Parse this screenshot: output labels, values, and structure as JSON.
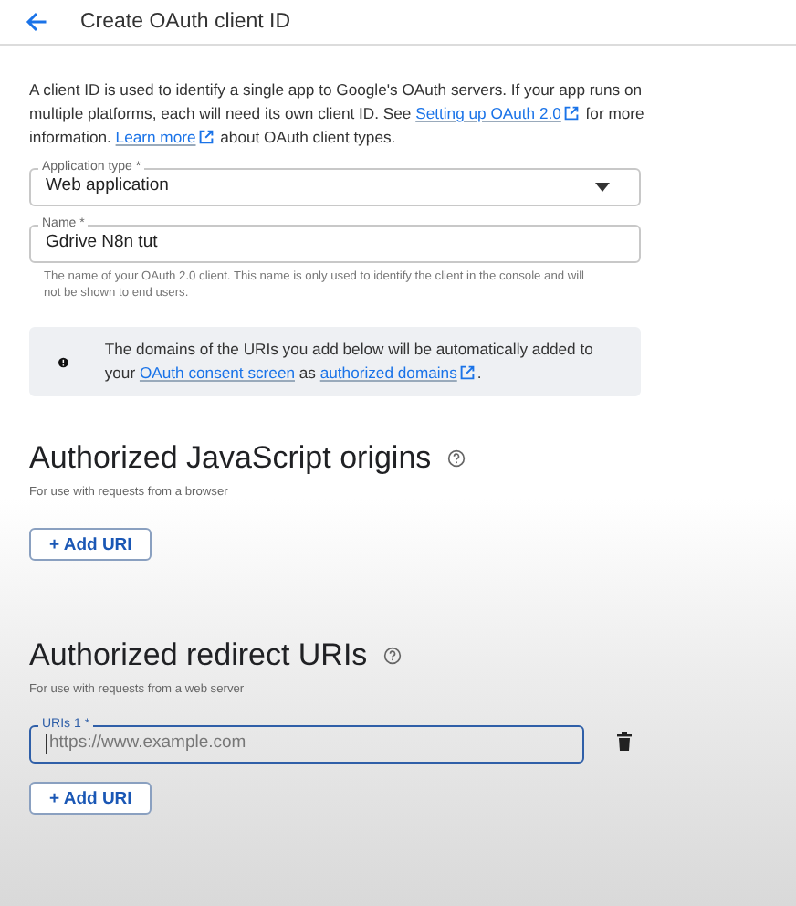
{
  "header": {
    "title": "Create OAuth client ID"
  },
  "intro": [
    {
      "kind": "text",
      "text": "A client ID is used to identify a single app to Google's OAuth servers. If your app runs on multiple platforms, each will need its own client ID. See "
    },
    {
      "kind": "link",
      "text": "Setting up OAuth 2.0",
      "external": true
    },
    {
      "kind": "text",
      "text": " for more information. "
    },
    {
      "kind": "link",
      "text": "Learn more",
      "external": true
    },
    {
      "kind": "text",
      "text": " about OAuth client types."
    }
  ],
  "application_type": {
    "label": "Application type *",
    "value": "Web application"
  },
  "name_field": {
    "label": "Name *",
    "value": "Gdrive N8n tut",
    "helper": "The name of your OAuth 2.0 client. This name is only used to identify the client in the console and will not be shown to end users."
  },
  "notice": [
    {
      "kind": "text",
      "text": "The domains of the URIs you add below will be automatically added to your "
    },
    {
      "kind": "link",
      "text": "OAuth consent screen",
      "external": false
    },
    {
      "kind": "text",
      "text": " as "
    },
    {
      "kind": "link",
      "text": "authorized domains",
      "external": true
    },
    {
      "kind": "text",
      "text": "."
    }
  ],
  "sections": [
    {
      "title": "Authorized JavaScript origins",
      "subtitle": "For use with requests from a browser",
      "add_button": "+ Add URI"
    },
    {
      "title": "Authorized redirect URIs",
      "subtitle": "For use with requests from a web server",
      "uris": [
        {
          "label": "URIs 1 *",
          "placeholder": "https://www.example.com",
          "focused": true
        }
      ],
      "add_button": "+ Add URI"
    }
  ]
}
